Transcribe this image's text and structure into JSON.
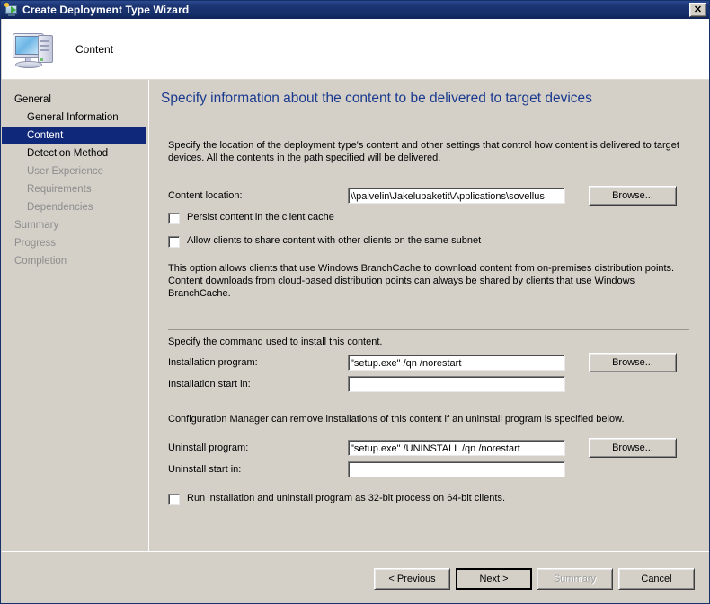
{
  "window": {
    "title": "Create Deployment Type Wizard",
    "close_label": "✕",
    "title_icon": "deployment-type-icon",
    "header_title": "Content",
    "header_icon": "computer-icon"
  },
  "sidebar": {
    "items": [
      {
        "label": "General",
        "level": 0,
        "state": "normal"
      },
      {
        "label": "General Information",
        "level": 1,
        "state": "normal"
      },
      {
        "label": "Content",
        "level": 1,
        "state": "selected"
      },
      {
        "label": "Detection Method",
        "level": 1,
        "state": "normal"
      },
      {
        "label": "User Experience",
        "level": 1,
        "state": "disabled"
      },
      {
        "label": "Requirements",
        "level": 1,
        "state": "disabled"
      },
      {
        "label": "Dependencies",
        "level": 1,
        "state": "disabled"
      },
      {
        "label": "Summary",
        "level": 0,
        "state": "disabled"
      },
      {
        "label": "Progress",
        "level": 0,
        "state": "disabled"
      },
      {
        "label": "Completion",
        "level": 0,
        "state": "disabled"
      }
    ]
  },
  "main": {
    "heading": "Specify information about the content to be delivered to target devices",
    "intro": "Specify the location of the deployment type's content and other settings that control how content is delivered to target devices. All the contents in the path specified will be delivered.",
    "content_location_label": "Content location:",
    "content_location_value": "\\\\palvelin\\Jakelupaketit\\Applications\\sovellus",
    "browse_label": "Browse...",
    "persist_cache_label": "Persist content in the client cache",
    "persist_cache_checked": false,
    "share_subnet_label": "Allow clients to share content with other clients on the same subnet",
    "share_subnet_checked": false,
    "branchcache_note": "This option allows clients that use Windows BranchCache to download content from on-premises distribution points. Content downloads from cloud-based distribution points can always be shared by clients that use Windows BranchCache.",
    "install_section_note": "Specify the command used to install this content.",
    "installation_program_label": "Installation program:",
    "installation_program_value": "\"setup.exe\" /qn /norestart",
    "installation_start_in_label": "Installation start in:",
    "installation_start_in_value": "",
    "uninstall_section_note": "Configuration Manager can remove installations of this content if an uninstall program is specified below.",
    "uninstall_program_label": "Uninstall program:",
    "uninstall_program_value": "\"setup.exe\" /UNINSTALL /qn /norestart",
    "uninstall_start_in_label": "Uninstall start in:",
    "uninstall_start_in_value": "",
    "run_32bit_label": "Run installation and uninstall program as 32-bit process on 64-bit clients.",
    "run_32bit_checked": false
  },
  "footer": {
    "previous_label": "< Previous",
    "next_label": "Next >",
    "summary_label": "Summary",
    "cancel_label": "Cancel"
  },
  "colors": {
    "titlebar": "#16306a",
    "heading": "#1b3a8f",
    "selection": "#10287a",
    "window_face": "#d4d0c8",
    "disabled_text": "#8d8d8d"
  }
}
